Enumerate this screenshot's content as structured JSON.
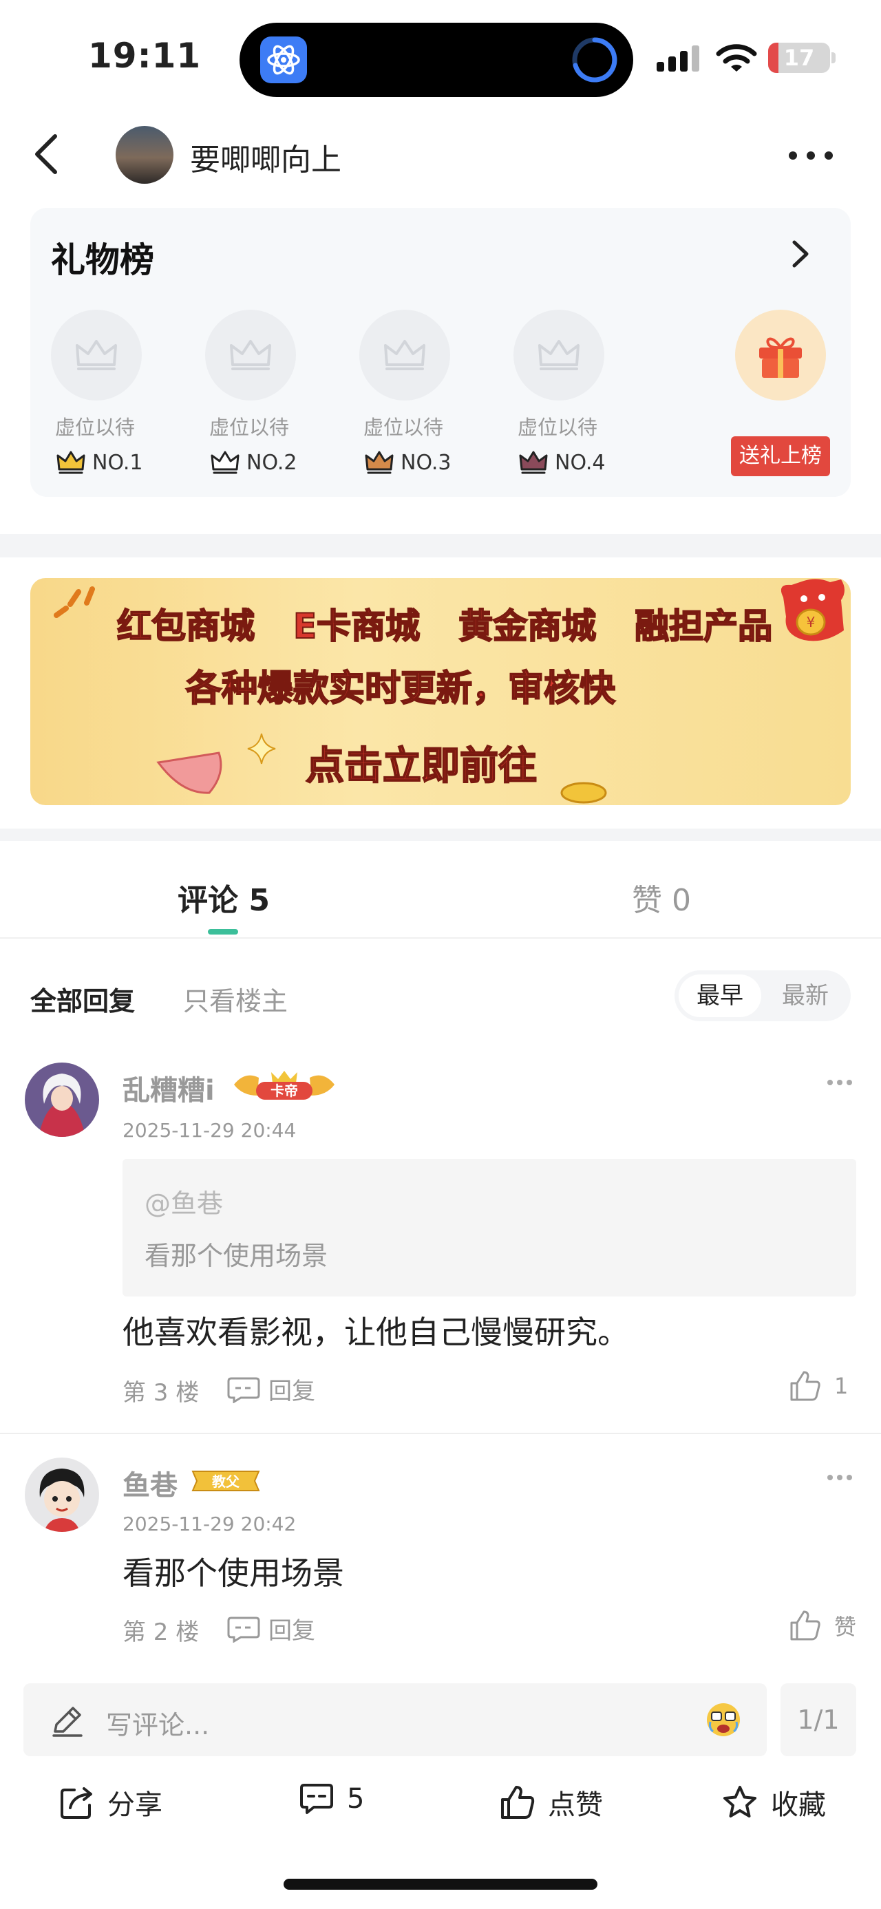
{
  "status_bar": {
    "time": "19:11",
    "battery_level": "17",
    "battery_fraction": 0.17,
    "island_app_color": "#3d7cf5"
  },
  "nav": {
    "title": "要唧唧向上",
    "back_icon": "chevron-left-icon",
    "more_icon": "ellipsis-icon"
  },
  "gift_board": {
    "title": "礼物榜",
    "slots": [
      {
        "label": "虚位以待",
        "rank": "NO.1",
        "crown_color": "#f2c43a"
      },
      {
        "label": "虚位以待",
        "rank": "NO.2",
        "crown_color": "#ffffff"
      },
      {
        "label": "虚位以待",
        "rank": "NO.3",
        "crown_color": "#d48a4a"
      },
      {
        "label": "虚位以待",
        "rank": "NO.4",
        "crown_color": "#8a4a5a"
      }
    ],
    "send_button": "送礼上榜"
  },
  "banner": {
    "row1": [
      "红包商城",
      "E卡商城",
      "黄金商城",
      "融担产品"
    ],
    "row2": "各种爆款实时更新，审核快",
    "row3": "点击立即前往"
  },
  "tabs": {
    "comments_label": "评论 5",
    "likes_label": "赞 0",
    "accent": "#3cbf9a"
  },
  "filter": {
    "all": "全部回复",
    "owner_only": "只看楼主",
    "sort_earliest": "最早",
    "sort_newest": "最新"
  },
  "comments": [
    {
      "name": "乱糟糟i",
      "badge": "卡帝",
      "time": "2025-11-29 20:44",
      "quote_user": "@鱼巷",
      "quote_text": "看那个使用场景",
      "text": "他喜欢看影视，让他自己慢慢研究。",
      "floor": "第 3 楼",
      "reply": "回复",
      "likes": "1"
    },
    {
      "name": "鱼巷",
      "badge": "教父",
      "time": "2025-11-29 20:42",
      "text": "看那个使用场景",
      "floor": "第 2 楼",
      "reply": "回复",
      "likes": "赞"
    }
  ],
  "input": {
    "placeholder": "写评论...",
    "page": "1/1"
  },
  "actions": {
    "share": "分享",
    "comments": "5",
    "like": "点赞",
    "favorite": "收藏"
  }
}
